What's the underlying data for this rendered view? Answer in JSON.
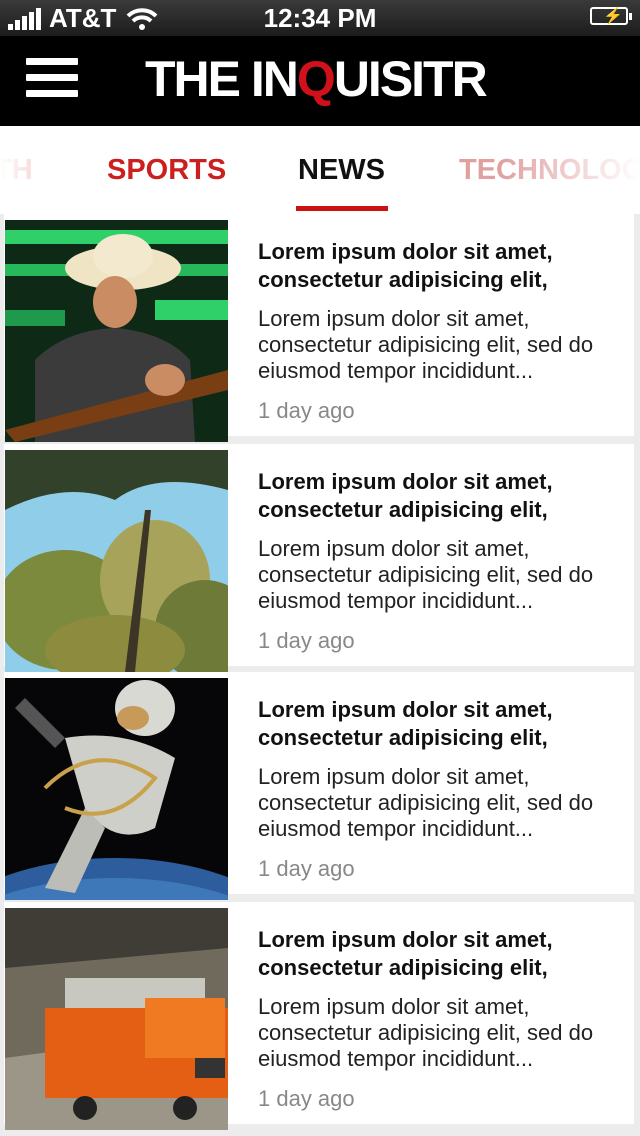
{
  "status_bar": {
    "carrier": "AT&T",
    "time": "12:34 PM"
  },
  "header": {
    "logo_prefix": "THE IN",
    "logo_q": "Q",
    "logo_suffix": "UISITR"
  },
  "tabs": [
    {
      "label": "TH"
    },
    {
      "label": "SPORTS"
    },
    {
      "label": "NEWS",
      "active": true
    },
    {
      "label": "TECHNOLOGY"
    }
  ],
  "articles": [
    {
      "title": "Lorem ipsum dolor sit amet, consectetur adipisicing elit,",
      "excerpt": "Lorem ipsum dolor sit amet, consectetur adipisicing elit, sed do eiusmod tempor incididunt...",
      "time": "1 day ago",
      "image": "guitarist-photo"
    },
    {
      "title": "Lorem ipsum dolor sit amet, consectetur adipisicing elit,",
      "excerpt": "Lorem ipsum dolor sit amet, consectetur adipisicing elit, sed do eiusmod tempor incididunt...",
      "time": "1 day ago",
      "image": "trees-photo"
    },
    {
      "title": "Lorem ipsum dolor sit amet, consectetur adipisicing elit,",
      "excerpt": "Lorem ipsum dolor sit amet, consectetur adipisicing elit, sed do eiusmod tempor incididunt...",
      "time": "1 day ago",
      "image": "astronaut-photo"
    },
    {
      "title": "Lorem ipsum dolor sit amet, consectetur adipisicing elit,",
      "excerpt": "Lorem ipsum dolor sit amet, consectetur adipisicing elit, sed do eiusmod tempor incididunt...",
      "time": "1 day ago",
      "image": "tunnel-machinery-photo"
    }
  ],
  "colors": {
    "accent": "#cc1111",
    "header_bg": "#000000"
  }
}
